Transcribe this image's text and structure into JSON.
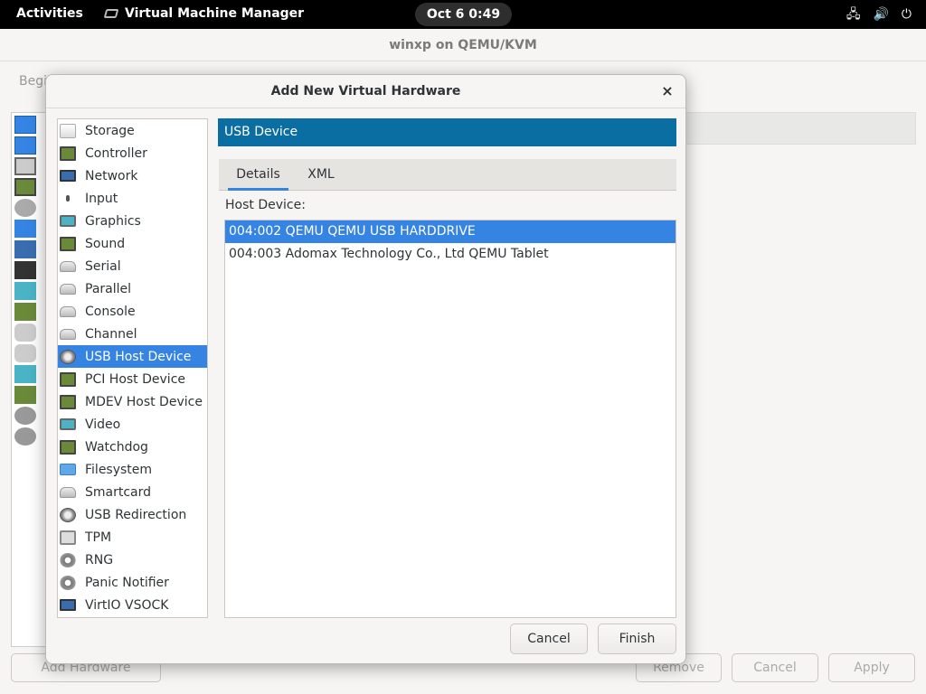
{
  "topbar": {
    "activities": "Activities",
    "app_name": "Virtual Machine Manager",
    "clock": "Oct 6  0:49",
    "tray_icons": [
      "network-icon",
      "volume-icon",
      "power-icon"
    ]
  },
  "main_window": {
    "title": "winxp on QEMU/KVM",
    "partial_label": "Begi",
    "add_hardware": "Add Hardware",
    "remove": "Remove",
    "cancel": "Cancel",
    "apply": "Apply"
  },
  "dialog": {
    "title": "Add New Virtual Hardware",
    "close_glyph": "×",
    "hardware_types": [
      {
        "label": "Storage",
        "icon": "storage-icon"
      },
      {
        "label": "Controller",
        "icon": "controller-icon"
      },
      {
        "label": "Network",
        "icon": "network-icon"
      },
      {
        "label": "Input",
        "icon": "input-icon"
      },
      {
        "label": "Graphics",
        "icon": "graphics-icon"
      },
      {
        "label": "Sound",
        "icon": "sound-icon"
      },
      {
        "label": "Serial",
        "icon": "serial-icon"
      },
      {
        "label": "Parallel",
        "icon": "parallel-icon"
      },
      {
        "label": "Console",
        "icon": "console-icon"
      },
      {
        "label": "Channel",
        "icon": "channel-icon"
      },
      {
        "label": "USB Host Device",
        "icon": "usb-icon"
      },
      {
        "label": "PCI Host Device",
        "icon": "pci-icon"
      },
      {
        "label": "MDEV Host Device",
        "icon": "mdev-icon"
      },
      {
        "label": "Video",
        "icon": "video-icon"
      },
      {
        "label": "Watchdog",
        "icon": "watchdog-icon"
      },
      {
        "label": "Filesystem",
        "icon": "filesystem-icon"
      },
      {
        "label": "Smartcard",
        "icon": "smartcard-icon"
      },
      {
        "label": "USB Redirection",
        "icon": "usb-redirection-icon"
      },
      {
        "label": "TPM",
        "icon": "tpm-icon"
      },
      {
        "label": "RNG",
        "icon": "rng-icon"
      },
      {
        "label": "Panic Notifier",
        "icon": "panic-notifier-icon"
      },
      {
        "label": "VirtIO VSOCK",
        "icon": "vsock-icon"
      }
    ],
    "selected_type": "USB Host Device",
    "section_header": "USB Device",
    "tabs": [
      "Details",
      "XML"
    ],
    "active_tab": "Details",
    "host_device_label": "Host Device:",
    "host_devices": [
      "004:002 QEMU QEMU USB HARDDRIVE",
      "004:003 Adomax Technology Co., Ltd QEMU Tablet"
    ],
    "selected_device": "004:002 QEMU QEMU USB HARDDRIVE",
    "cancel_button": "Cancel",
    "finish_button": "Finish"
  },
  "colors": {
    "accent": "#3584e4",
    "header_bar": "#0b6ea3"
  }
}
